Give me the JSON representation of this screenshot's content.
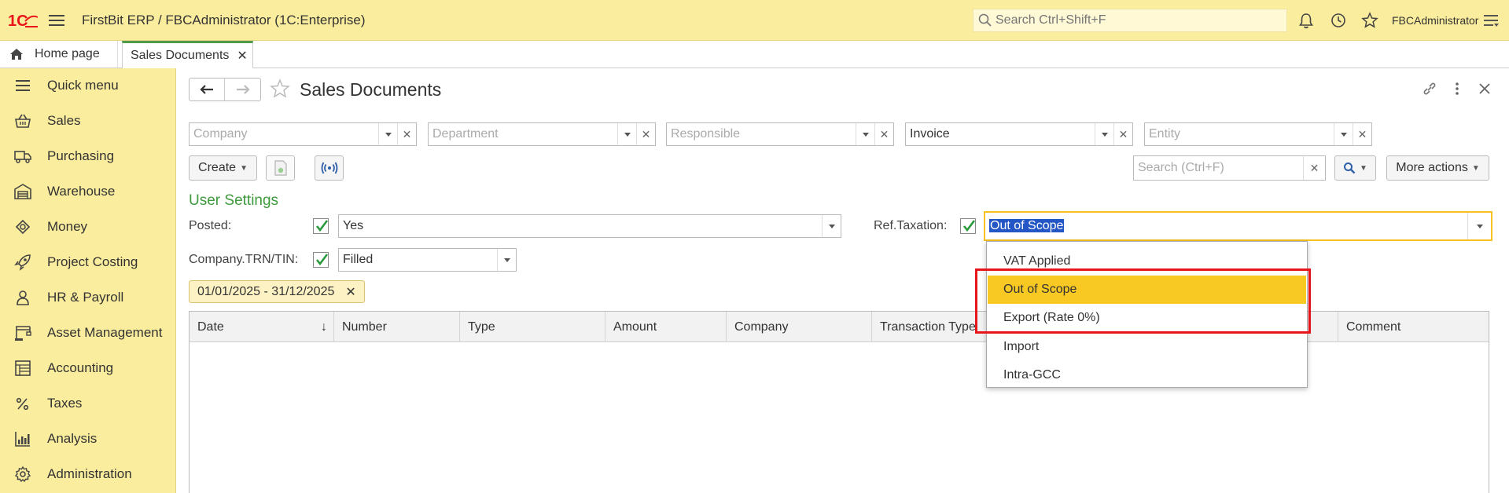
{
  "app": {
    "title": "FirstBit ERP / FBCAdministrator  (1C:Enterprise)",
    "search_placeholder": "Search Ctrl+Shift+F",
    "username": "FBCAdministrator",
    "brand_color": "#e8161a",
    "accent_color": "#fbed9e"
  },
  "tabs": [
    {
      "label": "Home page",
      "icon": "home-icon"
    },
    {
      "label": "Sales Documents",
      "active": true
    }
  ],
  "sidebar": {
    "items": [
      {
        "label": "Quick menu",
        "icon": "list-icon"
      },
      {
        "label": "Sales",
        "icon": "basket-icon"
      },
      {
        "label": "Purchasing",
        "icon": "truck-icon"
      },
      {
        "label": "Warehouse",
        "icon": "warehouse-icon"
      },
      {
        "label": "Money",
        "icon": "money-icon"
      },
      {
        "label": "Project Costing",
        "icon": "rocket-icon"
      },
      {
        "label": "HR & Payroll",
        "icon": "person-icon"
      },
      {
        "label": "Asset Management",
        "icon": "crane-icon"
      },
      {
        "label": "Accounting",
        "icon": "ledger-icon"
      },
      {
        "label": "Taxes",
        "icon": "percent-icon"
      },
      {
        "label": "Analysis",
        "icon": "chart-icon"
      },
      {
        "label": "Administration",
        "icon": "gear-icon"
      }
    ]
  },
  "page": {
    "title": "Sales Documents",
    "filters": {
      "company": {
        "placeholder": "Company",
        "value": ""
      },
      "department": {
        "placeholder": "Department",
        "value": ""
      },
      "responsible": {
        "placeholder": "Responsible",
        "value": ""
      },
      "type": {
        "value": "Invoice"
      },
      "entity": {
        "placeholder": "Entity",
        "value": ""
      }
    },
    "toolbar": {
      "create_label": "Create",
      "search_placeholder": "Search (Ctrl+F)",
      "more_actions_label": "More actions"
    },
    "user_settings": {
      "title": "User Settings",
      "posted_label": "Posted:",
      "posted_value": "Yes",
      "ref_taxation_label": "Ref.Taxation:",
      "ref_taxation_value": "Out of Scope",
      "trn_label": "Company.TRN/TIN:",
      "trn_value": "Filled"
    },
    "date_range": "01/01/2025 - 31/12/2025",
    "grid": {
      "columns": [
        "Date",
        "Number",
        "Type",
        "Amount",
        "Company",
        "Transaction Type",
        "Comment"
      ]
    },
    "dropdown": {
      "options": [
        "VAT Applied",
        "Out of Scope",
        "Export (Rate 0%)",
        "Import",
        "Intra-GCC"
      ],
      "selected_index": 1
    }
  }
}
